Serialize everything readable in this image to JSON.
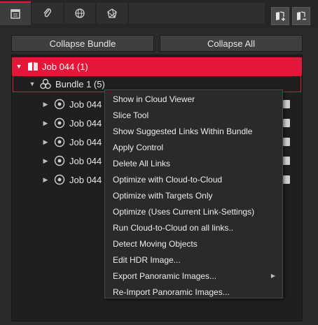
{
  "tabs": [
    {
      "name": "tab-project",
      "icon": "project-panel-icon",
      "active": true
    },
    {
      "name": "tab-attachments",
      "icon": "paperclip-icon",
      "active": false
    },
    {
      "name": "tab-web",
      "icon": "globe-icon",
      "active": false
    },
    {
      "name": "tab-network",
      "icon": "network-polygon-icon",
      "active": false
    }
  ],
  "corner_buttons": [
    {
      "name": "add-job-button",
      "icon": "book-plus-icon"
    },
    {
      "name": "remove-job-button",
      "icon": "book-minus-icon"
    }
  ],
  "buttons": {
    "collapse_bundle": "Collapse Bundle",
    "collapse_all": "Collapse All"
  },
  "tree": {
    "job": {
      "label": "Job 044 (1)",
      "icon": "job-book-icon"
    },
    "bundle": {
      "label": "Bundle 1 (5)",
      "icon": "bundle-icon"
    },
    "scans": [
      {
        "label": "Job 044"
      },
      {
        "label": "Job 044"
      },
      {
        "label": "Job 044"
      },
      {
        "label": "Job 044"
      },
      {
        "label": "Job 044"
      }
    ]
  },
  "context_menu": [
    {
      "label": "Show in Cloud Viewer",
      "submenu": false
    },
    {
      "label": "Slice Tool",
      "submenu": false
    },
    {
      "label": "Show Suggested Links Within Bundle",
      "submenu": false
    },
    {
      "label": "Apply Control",
      "submenu": false
    },
    {
      "label": "Delete All Links",
      "submenu": false
    },
    {
      "label": "Optimize with Cloud-to-Cloud",
      "submenu": false
    },
    {
      "label": "Optimize with Targets Only",
      "submenu": false
    },
    {
      "label": "Optimize (Uses Current Link-Settings)",
      "submenu": false
    },
    {
      "label": "Run Cloud-to-Cloud on all links..",
      "submenu": false
    },
    {
      "label": "Detect Moving Objects",
      "submenu": false
    },
    {
      "label": "Edit HDR Image...",
      "submenu": false
    },
    {
      "label": "Export Panoramic Images...",
      "submenu": true
    },
    {
      "label": "Re-Import Panoramic Images...",
      "submenu": false
    }
  ],
  "colors": {
    "accent": "#e4163a",
    "background": "#2b2b2b",
    "panel": "#1f1f1f",
    "menu": "#2a2a2a"
  }
}
